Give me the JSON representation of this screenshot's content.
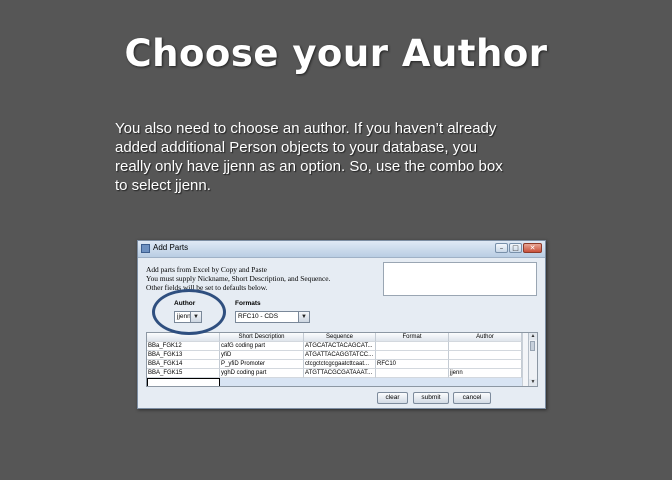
{
  "slide": {
    "title": "Choose your Author",
    "body_lines": [
      "You also need to choose an author.  If you haven’t already",
      "added additional Person objects to your database, you",
      "really only have jjenn as an option.  So, use the combo box",
      "to select jjenn."
    ]
  },
  "window": {
    "title": "Add Parts",
    "controls": {
      "minimize": "–",
      "maximize": "□",
      "close": "✕"
    },
    "instructions": [
      "Add parts from Excel by Copy and Paste",
      "You must supply Nickname, Short Description, and Sequence.",
      "Other fields will be set to defaults below."
    ],
    "author": {
      "label": "Author",
      "value": "jjenn",
      "arrow": "▼"
    },
    "formats": {
      "label": "Formats",
      "value": "RFC10 - CDS",
      "arrow": "▼"
    },
    "table": {
      "columns": [
        "",
        "Short Description",
        "Sequence",
        "Format",
        "Author"
      ],
      "rows": [
        [
          "BBa_FGK12",
          "cafG coding part",
          "ATGCATACTACAGCAT...",
          "",
          ""
        ],
        [
          "BBA_FGK13",
          "yfiD",
          "ATGATTACAGGTATCC...",
          "",
          ""
        ],
        [
          "BBA_FGK14",
          "P_yfiD Promoter",
          "ctcgctctcgcgaatcttcaat...",
          "RFC10",
          ""
        ],
        [
          "BBA_FGK15",
          "yghD coding part",
          "ATGTTACGCGATAAAT...",
          "",
          "jjenn"
        ]
      ],
      "scroll_up": "▲",
      "scroll_down": "▼"
    },
    "buttons": {
      "clear": "clear",
      "submit": "submit",
      "cancel": "cancel"
    },
    "colors": {
      "highlight_ring": "#2f4f7f",
      "selected_row": "#d8e4f3",
      "background": "#565656"
    }
  }
}
